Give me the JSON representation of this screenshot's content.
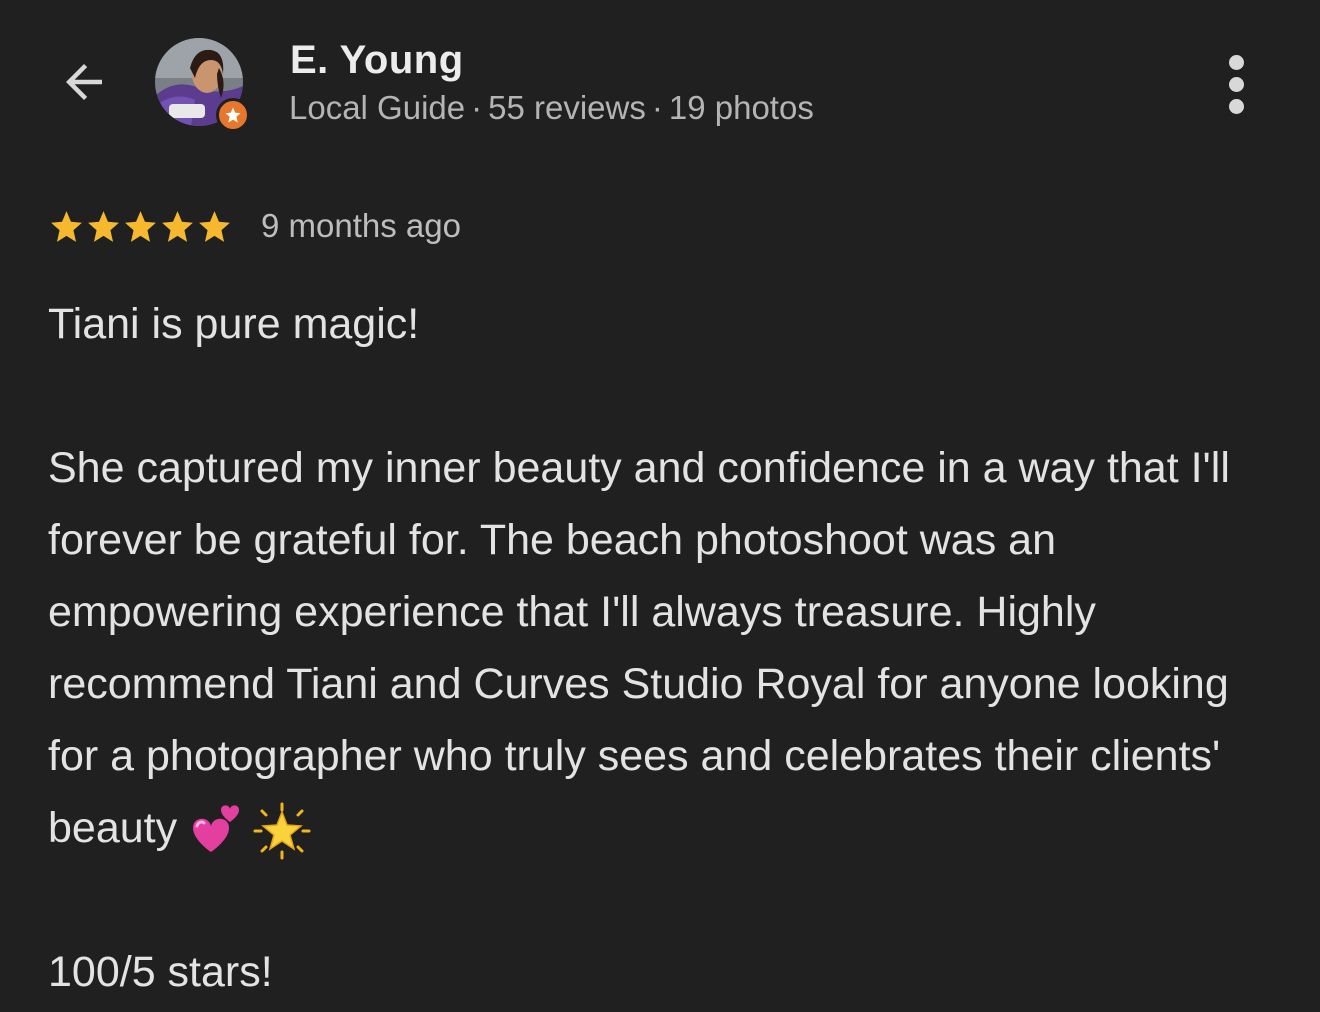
{
  "header": {
    "reviewer_name": "E. Young",
    "reviewer_level": "Local Guide",
    "review_count": "55 reviews",
    "photo_count": "19 photos",
    "separator": "·",
    "icons": {
      "back": "arrow-left-icon",
      "more": "more-vert-icon",
      "badge": "local-guide-star-icon"
    }
  },
  "rating": {
    "stars": 5,
    "max_stars": 5,
    "star_color": "#f5b82e",
    "date": "9 months ago"
  },
  "review": {
    "headline": "Tiani is pure magic!",
    "paragraph": "She captured my inner beauty and confidence in a way that I'll forever be grateful for. The beach photoshoot was an empowering experience that I'll always treasure. Highly recommend Tiani and Curves Studio Royal for anyone looking for a photographer who truly sees and celebrates their clients' beauty",
    "emojis": [
      "two-hearts-emoji",
      "glowing-star-emoji"
    ],
    "closing": "100/5 stars!"
  },
  "colors": {
    "background": "#202020",
    "text": "#e3e3e3",
    "secondary_text": "#b4b4b4",
    "badge": "#e8772e"
  }
}
